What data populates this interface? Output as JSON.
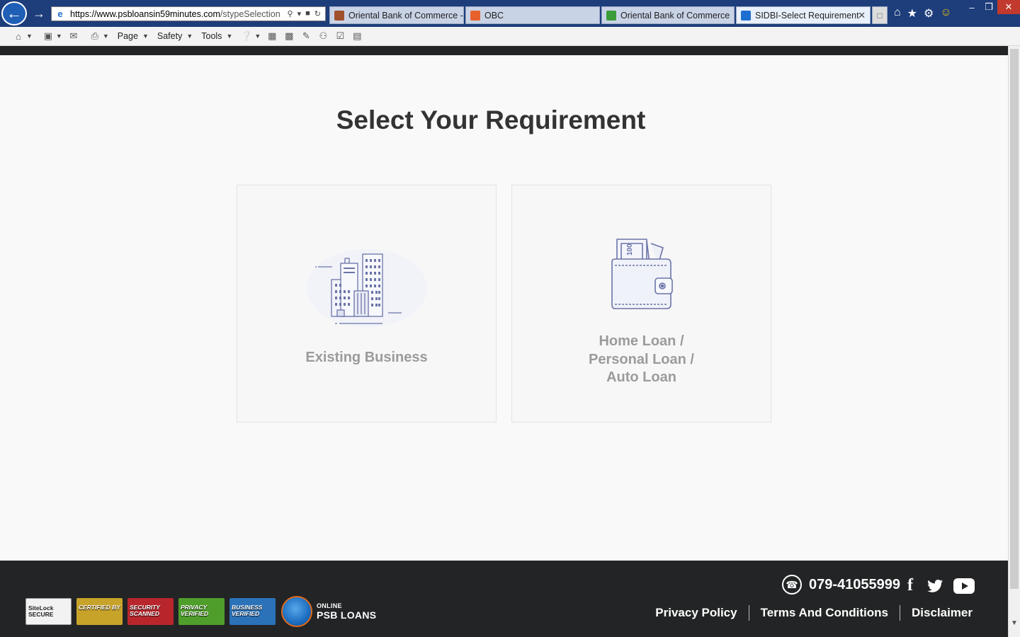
{
  "browser": {
    "url_domain": "https://www.psbloansin59minutes.com",
    "url_path": "/stypeSelection",
    "tabs": [
      {
        "label": "Oriental Bank of Commerce -...",
        "active": false,
        "icon_color": "#a0522d"
      },
      {
        "label": "OBC",
        "active": false,
        "icon_color": "#e8612c"
      },
      {
        "label": "Oriental Bank of Commerce",
        "active": false,
        "icon_color": "#3a9d3a"
      },
      {
        "label": "SIDBI-Select Requirement",
        "active": true,
        "icon_color": "#1f6fd0"
      }
    ],
    "command_menus": [
      "Page",
      "Safety",
      "Tools"
    ]
  },
  "page": {
    "heading": "Select Your Requirement",
    "options": [
      {
        "label": "Existing Business",
        "icon": "office-buildings-icon"
      },
      {
        "label_lines": [
          "Home Loan /",
          "Personal Loan /",
          "Auto Loan"
        ],
        "icon": "wallet-money-icon"
      }
    ]
  },
  "footer": {
    "phone": "079-41055999",
    "links": [
      "Privacy Policy",
      "Terms And Conditions",
      "Disclaimer"
    ],
    "logo_line1": "ONLINE",
    "logo_line2": "PSB LOANS",
    "badges": [
      {
        "label": "SiteLock SECURE",
        "color": "#f2f2f2"
      },
      {
        "label": "CERTIFIED BY",
        "color": "#c8a32a"
      },
      {
        "label": "SECURITY SCANNED",
        "color": "#b8262c"
      },
      {
        "label": "PRIVACY VERIFIED",
        "color": "#4f9e2b"
      },
      {
        "label": "BUSINESS VERIFIED",
        "color": "#2b72b8"
      }
    ],
    "social": [
      "facebook-icon",
      "twitter-icon",
      "youtube-icon"
    ]
  },
  "colors": {
    "chrome_bg": "#1d3d7b",
    "page_bg": "#f9f9f9",
    "footer_bg": "#232425",
    "card_label": "#9b9b9b",
    "heading": "#333333"
  }
}
